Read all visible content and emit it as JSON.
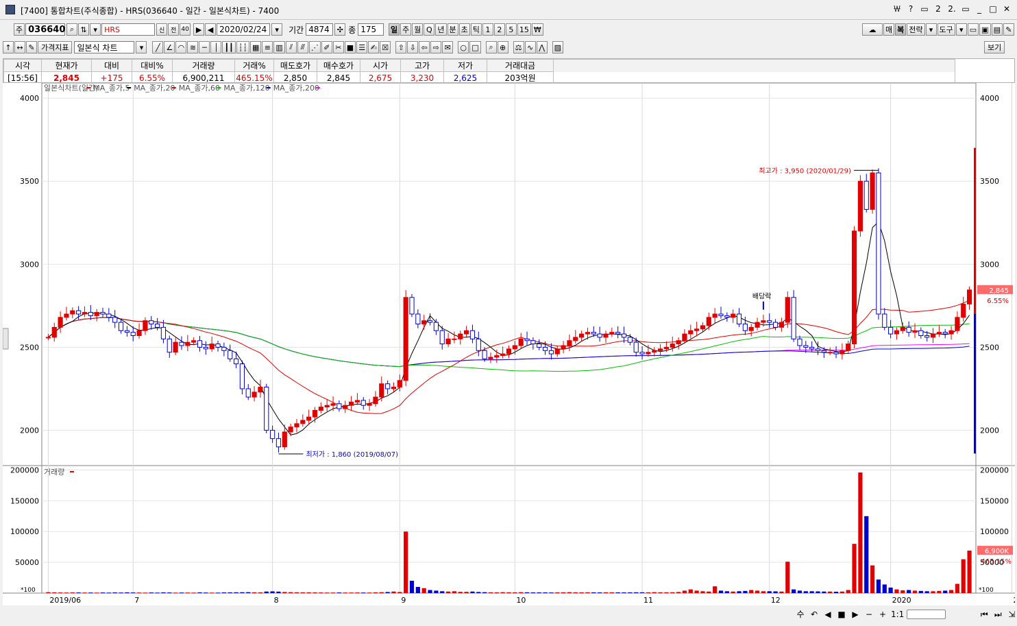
{
  "window": {
    "title": "[7400] 통합차트(주식종합) - HRS(036640 - 일간 - 일본식차트) - 7400",
    "controls": [
      "￦",
      "?",
      "▭",
      "2",
      "2.",
      "▭",
      "_",
      "□",
      "✕"
    ]
  },
  "toolbar1": {
    "market_btn": "주",
    "code": "036640",
    "name": "HRS",
    "name_tags": [
      "신",
      "전",
      "40"
    ],
    "date": "2020/02/24",
    "period_label": "기간",
    "period_value": "4874",
    "count_label": "종",
    "count_value": "175",
    "intervals": [
      "일",
      "주",
      "월",
      "Q",
      "년",
      "분",
      "초",
      "틱",
      "1",
      "2",
      "5",
      "15",
      "₩"
    ],
    "right_btns": [
      "매",
      "복",
      "전략",
      "도구"
    ]
  },
  "toolbar2": {
    "indicator_btn": "가격지표",
    "chart_type": "일본식 차트",
    "view_btn": "보기"
  },
  "quote": {
    "headers": [
      "시각",
      "현재가",
      "대비",
      "대비%",
      "거래량",
      "거래%",
      "매도호가",
      "매수호가",
      "시가",
      "고가",
      "저가",
      "거래대금"
    ],
    "values": [
      "[15:56]",
      "2,845",
      "+175",
      "6.55%",
      "6,900,211",
      "465.15%",
      "2,850",
      "2,845",
      "2,675",
      "3,230",
      "2,625",
      "203억원"
    ]
  },
  "chart_data": {
    "type": "candlestick",
    "legend_price": [
      "일본식차트(일간)",
      "MA_종가,5",
      "MA_종가,20",
      "MA_종가,60",
      "MA_종가,120",
      "MA_종가,200"
    ],
    "legend_volume": [
      "거래량"
    ],
    "price_ticks": [
      "4000",
      "3500",
      "3000",
      "2500",
      "2000"
    ],
    "price_ylim": [
      1800,
      4050
    ],
    "volume_ticks": [
      "200000",
      "150000",
      "100000",
      "50000"
    ],
    "volume_unit": "*100",
    "volume_ylim": [
      0,
      205000
    ],
    "x_labels": [
      {
        "label": "2019/06",
        "index": 0
      },
      {
        "label": "7",
        "index": 14
      },
      {
        "label": "8",
        "index": 37
      },
      {
        "label": "9",
        "index": 58
      },
      {
        "label": "10",
        "index": 77
      },
      {
        "label": "11",
        "index": 98
      },
      {
        "label": "12",
        "index": 119
      },
      {
        "label": "2020",
        "index": 139
      },
      {
        "label": "2",
        "index": 159
      }
    ],
    "annotations": {
      "high": "최고가 : 3,950 (2020/01/29)",
      "low": "최저가 : 1,860 (2019/08/07)",
      "dividend": "배당락"
    },
    "last_price_tag": {
      "price": "2,845",
      "pct": "6.55%",
      "value": 2845
    },
    "last_volume_tag": {
      "volume": "6,900K",
      "pct": "465.15%",
      "value": 69002
    },
    "closes": [
      2560,
      2620,
      2680,
      2700,
      2720,
      2700,
      2710,
      2690,
      2710,
      2700,
      2680,
      2650,
      2600,
      2590,
      2570,
      2600,
      2660,
      2640,
      2620,
      2550,
      2470,
      2530,
      2510,
      2530,
      2540,
      2500,
      2490,
      2520,
      2500,
      2480,
      2430,
      2400,
      2250,
      2200,
      2230,
      2260,
      2000,
      1950,
      1900,
      1990,
      2020,
      2040,
      2060,
      2080,
      2120,
      2140,
      2150,
      2160,
      2130,
      2150,
      2170,
      2180,
      2150,
      2160,
      2200,
      2280,
      2250,
      2260,
      2300,
      2800,
      2700,
      2640,
      2660,
      2650,
      2600,
      2520,
      2550,
      2550,
      2580,
      2600,
      2550,
      2480,
      2430,
      2440,
      2450,
      2460,
      2490,
      2510,
      2550,
      2540,
      2520,
      2500,
      2480,
      2460,
      2490,
      2510,
      2540,
      2560,
      2580,
      2590,
      2580,
      2560,
      2580,
      2590,
      2580,
      2560,
      2530,
      2470,
      2460,
      2470,
      2480,
      2490,
      2500,
      2520,
      2540,
      2580,
      2600,
      2610,
      2630,
      2680,
      2700,
      2690,
      2680,
      2700,
      2640,
      2600,
      2620,
      2650,
      2660,
      2650,
      2620,
      2650,
      2800,
      2550,
      2510,
      2500,
      2490,
      2480,
      2470,
      2470,
      2460,
      2480,
      2520,
      3200,
      3500,
      3330,
      3550,
      2700,
      2620,
      2580,
      2600,
      2620,
      2590,
      2600,
      2570,
      2560,
      2580,
      2590,
      2580,
      2600,
      2680,
      2760,
      2845
    ],
    "volumes": [
      1500,
      1200,
      1000,
      900,
      1100,
      1000,
      900,
      900,
      800,
      1000,
      800,
      1100,
      900,
      1200,
      1000,
      900,
      800,
      1000,
      800,
      1200,
      1000,
      800,
      900,
      900,
      800,
      1200,
      900,
      800,
      800,
      1100,
      1200,
      1300,
      1400,
      1500,
      1300,
      1200,
      2500,
      2800,
      2400,
      1800,
      1500,
      1300,
      1200,
      1200,
      1100,
      1000,
      900,
      900,
      1000,
      900,
      900,
      1000,
      900,
      900,
      1200,
      1500,
      1800,
      2500,
      1800,
      100000,
      20000,
      10000,
      8000,
      5000,
      4000,
      3000,
      2500,
      3000,
      2000,
      2000,
      2500,
      1800,
      1500,
      1300,
      1200,
      1500,
      1300,
      1200,
      1500,
      1300,
      1100,
      1100,
      1100,
      1000,
      1200,
      1300,
      1500,
      1300,
      1200,
      1300,
      1200,
      1100,
      1300,
      1300,
      1200,
      1100,
      1200,
      1300,
      1300,
      1200,
      1500,
      1300,
      1300,
      1400,
      1800,
      4000,
      6000,
      4000,
      3000,
      2500,
      11000,
      4000,
      3000,
      2500,
      3000,
      3500,
      5000,
      4000,
      3000,
      3000,
      2800,
      2500,
      51000,
      6000,
      4000,
      3000,
      3000,
      2800,
      2500,
      2500,
      2200,
      2500,
      5000,
      80000,
      196000,
      125000,
      45000,
      22000,
      14000,
      9000,
      6000,
      4500,
      5000,
      4000,
      3500,
      3000,
      3000,
      3500,
      4000,
      5000,
      15000,
      55000,
      69002
    ]
  }
}
